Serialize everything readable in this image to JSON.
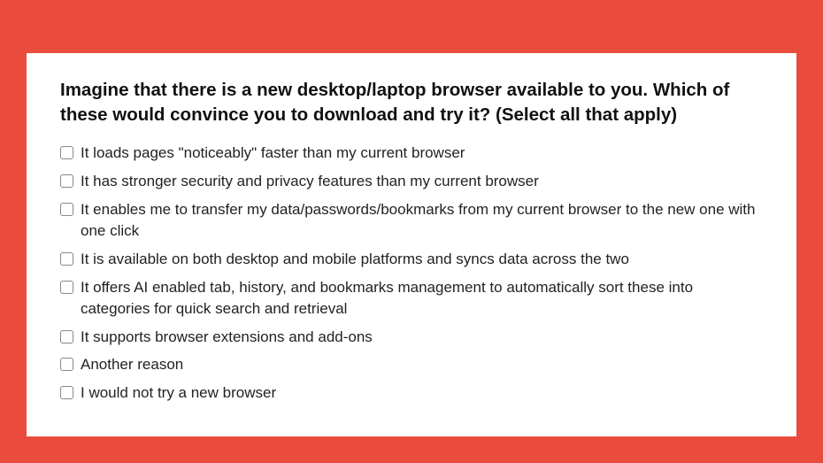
{
  "question": "Imagine that there is a new desktop/laptop browser available to you. Which of these would convince you to download and try it? (Select all that apply)",
  "options": [
    {
      "label": "It loads pages \"noticeably\" faster than my current browser",
      "checked": false
    },
    {
      "label": "It has stronger security and privacy features than my current browser",
      "checked": false
    },
    {
      "label": "It enables me to transfer my data/passwords/bookmarks from my current browser to the new one with one click",
      "checked": false
    },
    {
      "label": "It is available on both desktop and mobile platforms and syncs data across the two",
      "checked": false
    },
    {
      "label": "It offers AI enabled tab, history, and bookmarks management to automatically sort these into categories for quick search and retrieval",
      "checked": false
    },
    {
      "label": "It supports browser extensions and add-ons",
      "checked": false
    },
    {
      "label": "Another reason",
      "checked": false
    },
    {
      "label": "I would not try a new browser",
      "checked": false
    }
  ]
}
